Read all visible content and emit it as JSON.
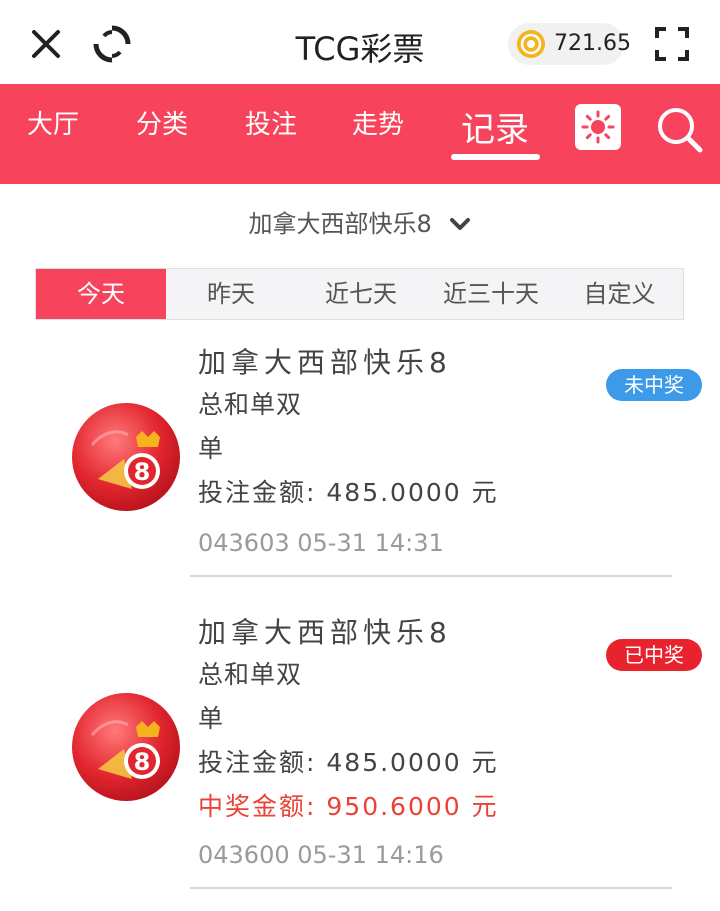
{
  "header": {
    "title": "TCG彩票",
    "balance": "721.65",
    "icons": {
      "close": "close-icon",
      "refresh": "refresh-icon",
      "coin": "coin-icon",
      "fullscreen": "fullscreen-icon"
    }
  },
  "nav": {
    "tabs": [
      {
        "label": "大厅",
        "active": false
      },
      {
        "label": "分类",
        "active": false
      },
      {
        "label": "投注",
        "active": false
      },
      {
        "label": "走势",
        "active": false
      },
      {
        "label": "记录",
        "active": true
      }
    ],
    "icons": {
      "theme": "sun-icon",
      "search": "search-icon"
    }
  },
  "game_select": {
    "label": "加拿大西部快乐8"
  },
  "date_filter": {
    "options": [
      "今天",
      "昨天",
      "近七天",
      "近三十天",
      "自定义"
    ],
    "selected": "今天"
  },
  "records": [
    {
      "game": "加拿大西部快乐8",
      "play": "总和单双",
      "pick": "单",
      "bet_label": "投注金额:",
      "bet_amount": "485.0000",
      "currency": "元",
      "status": "未中奖",
      "status_color": "#3d9ae8",
      "issue": "043603",
      "time": "05-31 14:31"
    },
    {
      "game": "加拿大西部快乐8",
      "play": "总和单双",
      "pick": "单",
      "bet_label": "投注金额:",
      "bet_amount": "485.0000",
      "currency": "元",
      "win_label": "中奖金额:",
      "win_amount": "950.6000",
      "status": "已中奖",
      "status_color": "#e9232e",
      "issue": "043600",
      "time": "05-31 14:16"
    }
  ],
  "colors": {
    "brand": "#f7435c",
    "win_text": "#ea4335",
    "lose_badge": "#3d9ae8",
    "win_badge": "#e9232e"
  }
}
